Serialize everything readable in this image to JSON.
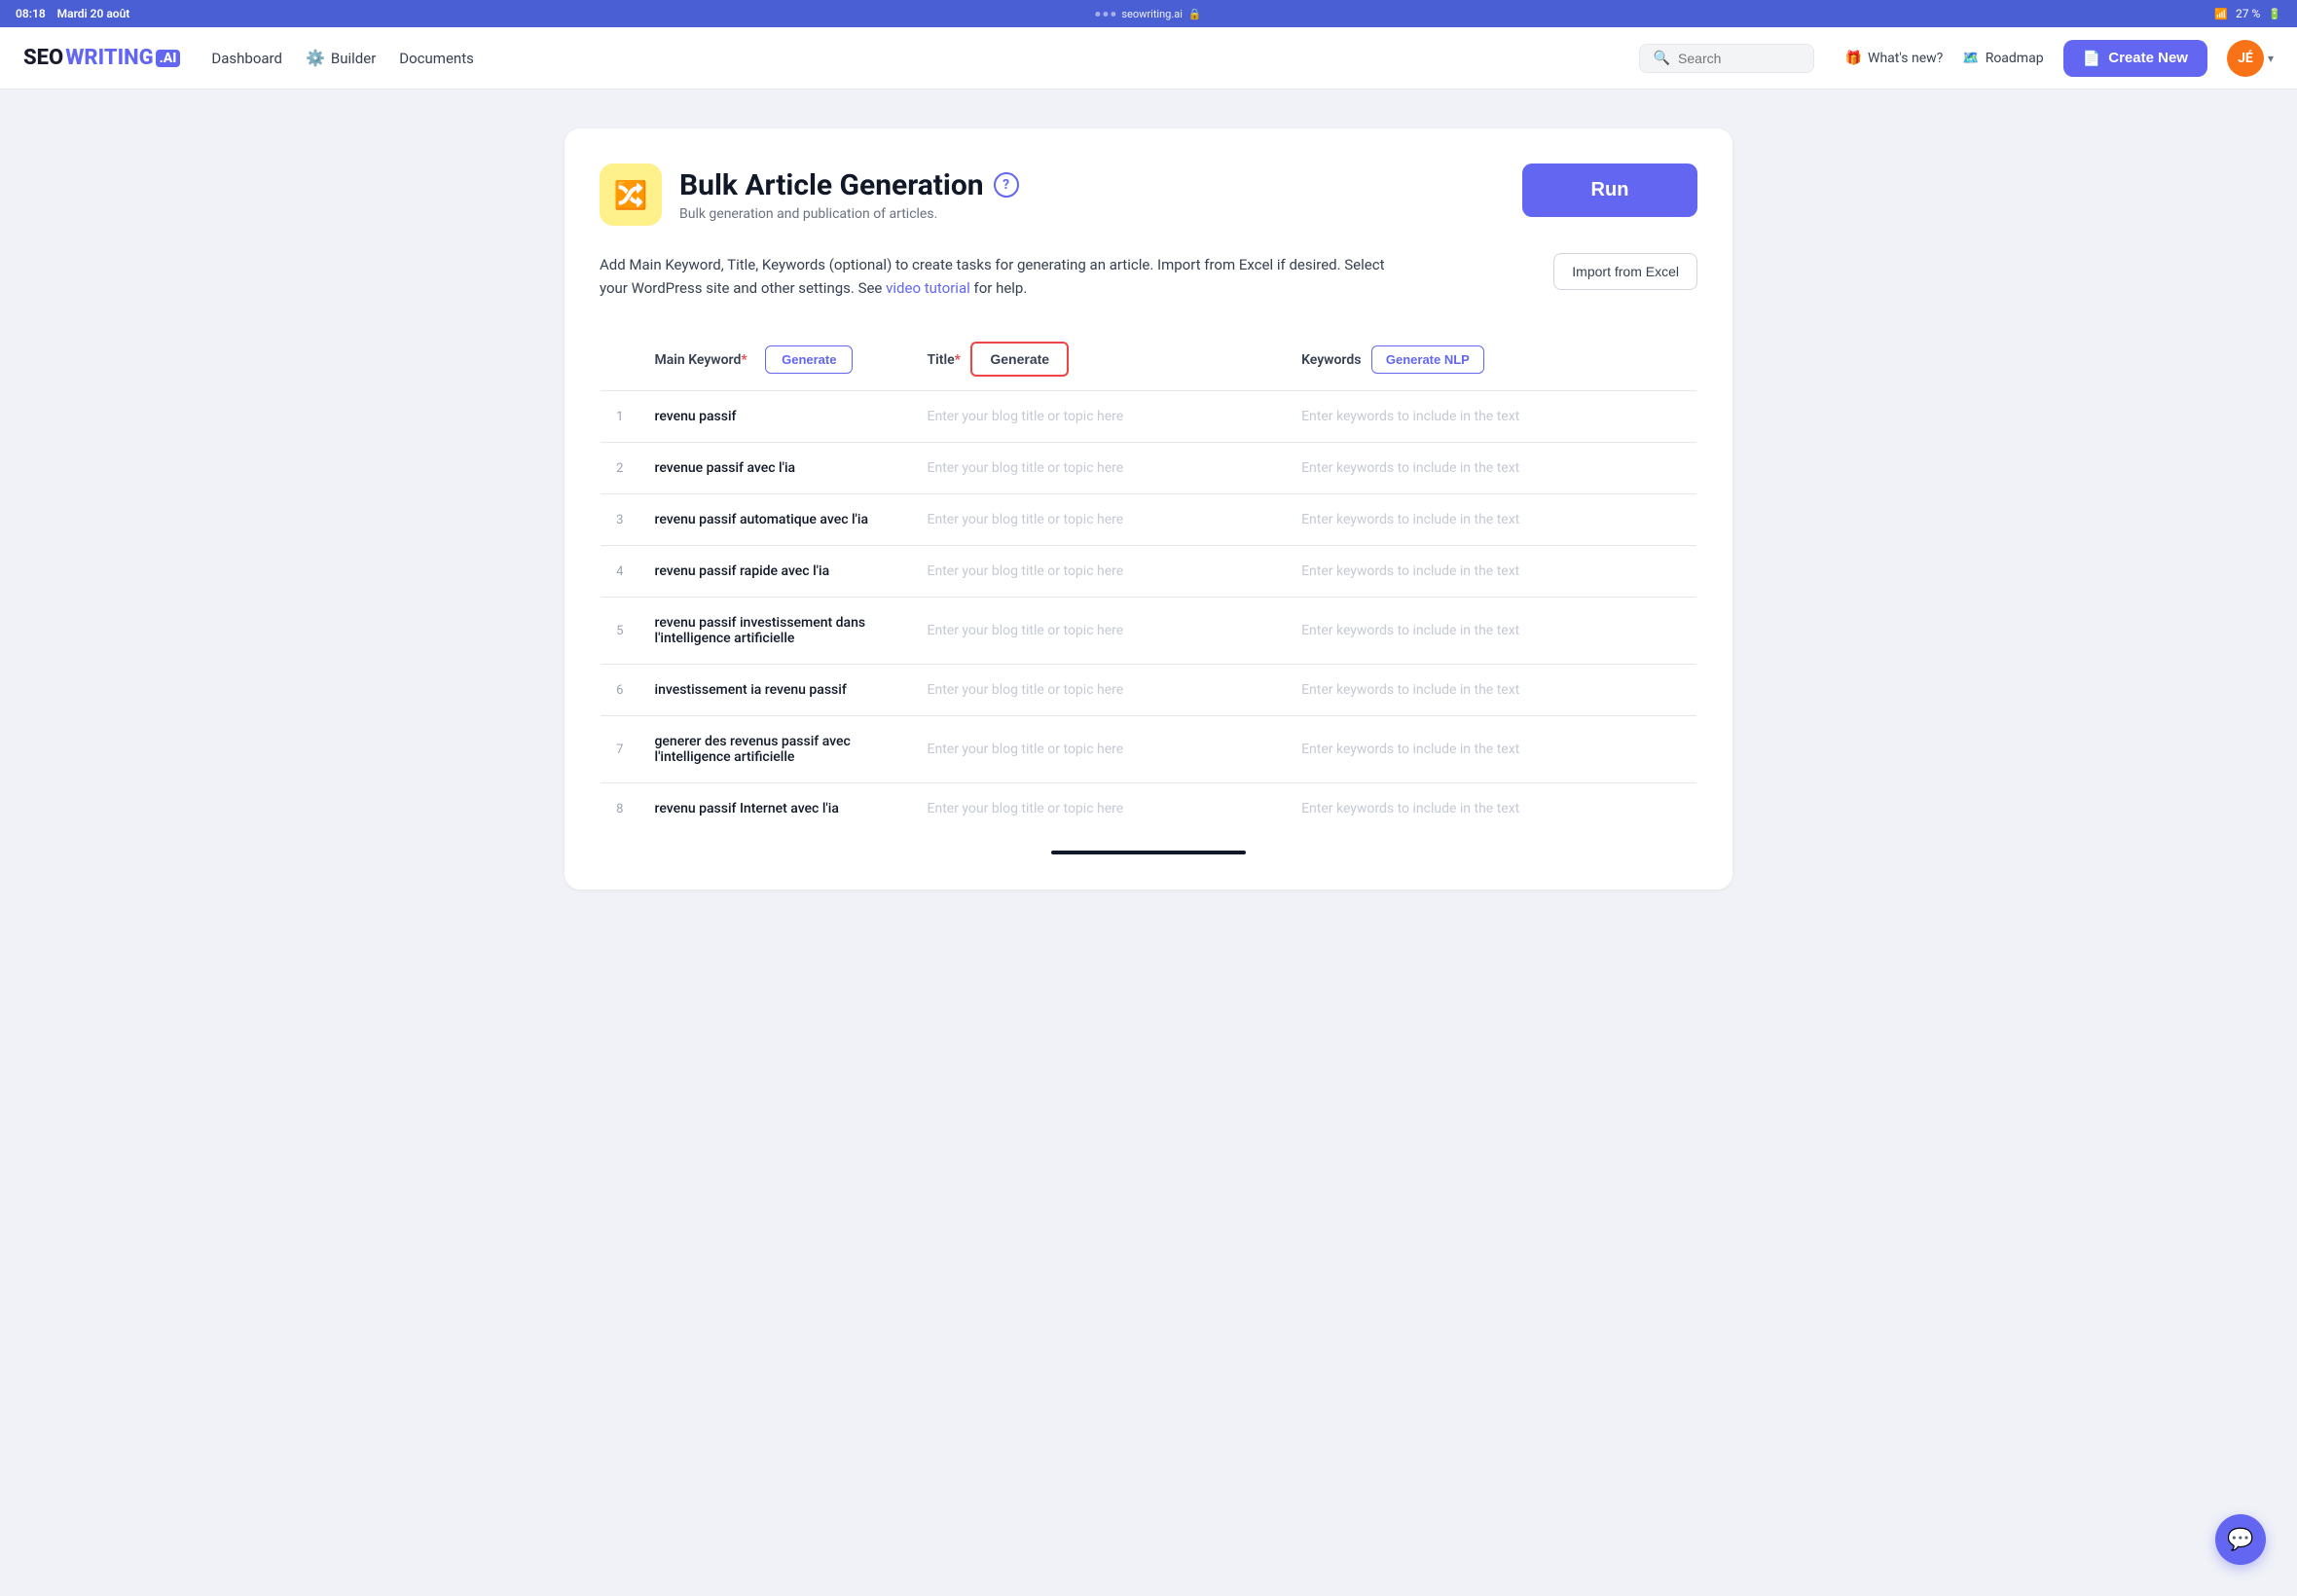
{
  "statusBar": {
    "time": "08:18",
    "date": "Mardi 20 août",
    "url": "seowriting.ai",
    "lock": "🔒",
    "wifi": "WiFi",
    "battery": "27 %"
  },
  "navbar": {
    "logo": {
      "seo": "SEO",
      "writing": "WRITING",
      "ai": ".AI"
    },
    "links": [
      {
        "label": "Dashboard",
        "icon": ""
      },
      {
        "label": "Builder",
        "icon": "⚙️"
      },
      {
        "label": "Documents",
        "icon": ""
      }
    ],
    "search": {
      "placeholder": "Search"
    },
    "whatsNew": "What's new?",
    "roadmap": "Roadmap",
    "createNew": "Create New",
    "userInitials": "JÉ"
  },
  "page": {
    "icon": "🔀",
    "title": "Bulk Article Generation",
    "subtitle": "Bulk generation and publication of articles.",
    "helpLabel": "?",
    "runButton": "Run",
    "description": "Add Main Keyword, Title, Keywords (optional) to create tasks for generating an article. Import from Excel if desired. Select your WordPress site and other settings. See",
    "descriptionLink": "video tutorial",
    "descriptionEnd": "for help.",
    "importButton": "Import from Excel"
  },
  "table": {
    "columns": {
      "rowNum": "",
      "mainKeyword": "Main Keyword",
      "mainKeywordRequired": "*",
      "generateKeyword": "Generate",
      "title": "Title",
      "titleRequired": "*",
      "generateTitle": "Generate",
      "keywords": "Keywords",
      "generateNLP": "Generate NLP"
    },
    "titlePlaceholder": "Enter your blog title or topic here",
    "keywordsPlaceholder": "Enter keywords to include in the text",
    "rows": [
      {
        "num": 1,
        "keyword": "revenu passif"
      },
      {
        "num": 2,
        "keyword": "revenue passif avec l'ia"
      },
      {
        "num": 3,
        "keyword": "revenu passif automatique avec l'ia"
      },
      {
        "num": 4,
        "keyword": "revenu passif rapide avec l'ia"
      },
      {
        "num": 5,
        "keyword": "revenu passif investissement dans l'intelligence artificielle"
      },
      {
        "num": 6,
        "keyword": "investissement ia revenu passif"
      },
      {
        "num": 7,
        "keyword": "generer des revenus passif avec l'intelligence artificielle"
      },
      {
        "num": 8,
        "keyword": "revenu passif Internet avec l'ia"
      }
    ]
  },
  "chat": {
    "icon": "💬"
  }
}
